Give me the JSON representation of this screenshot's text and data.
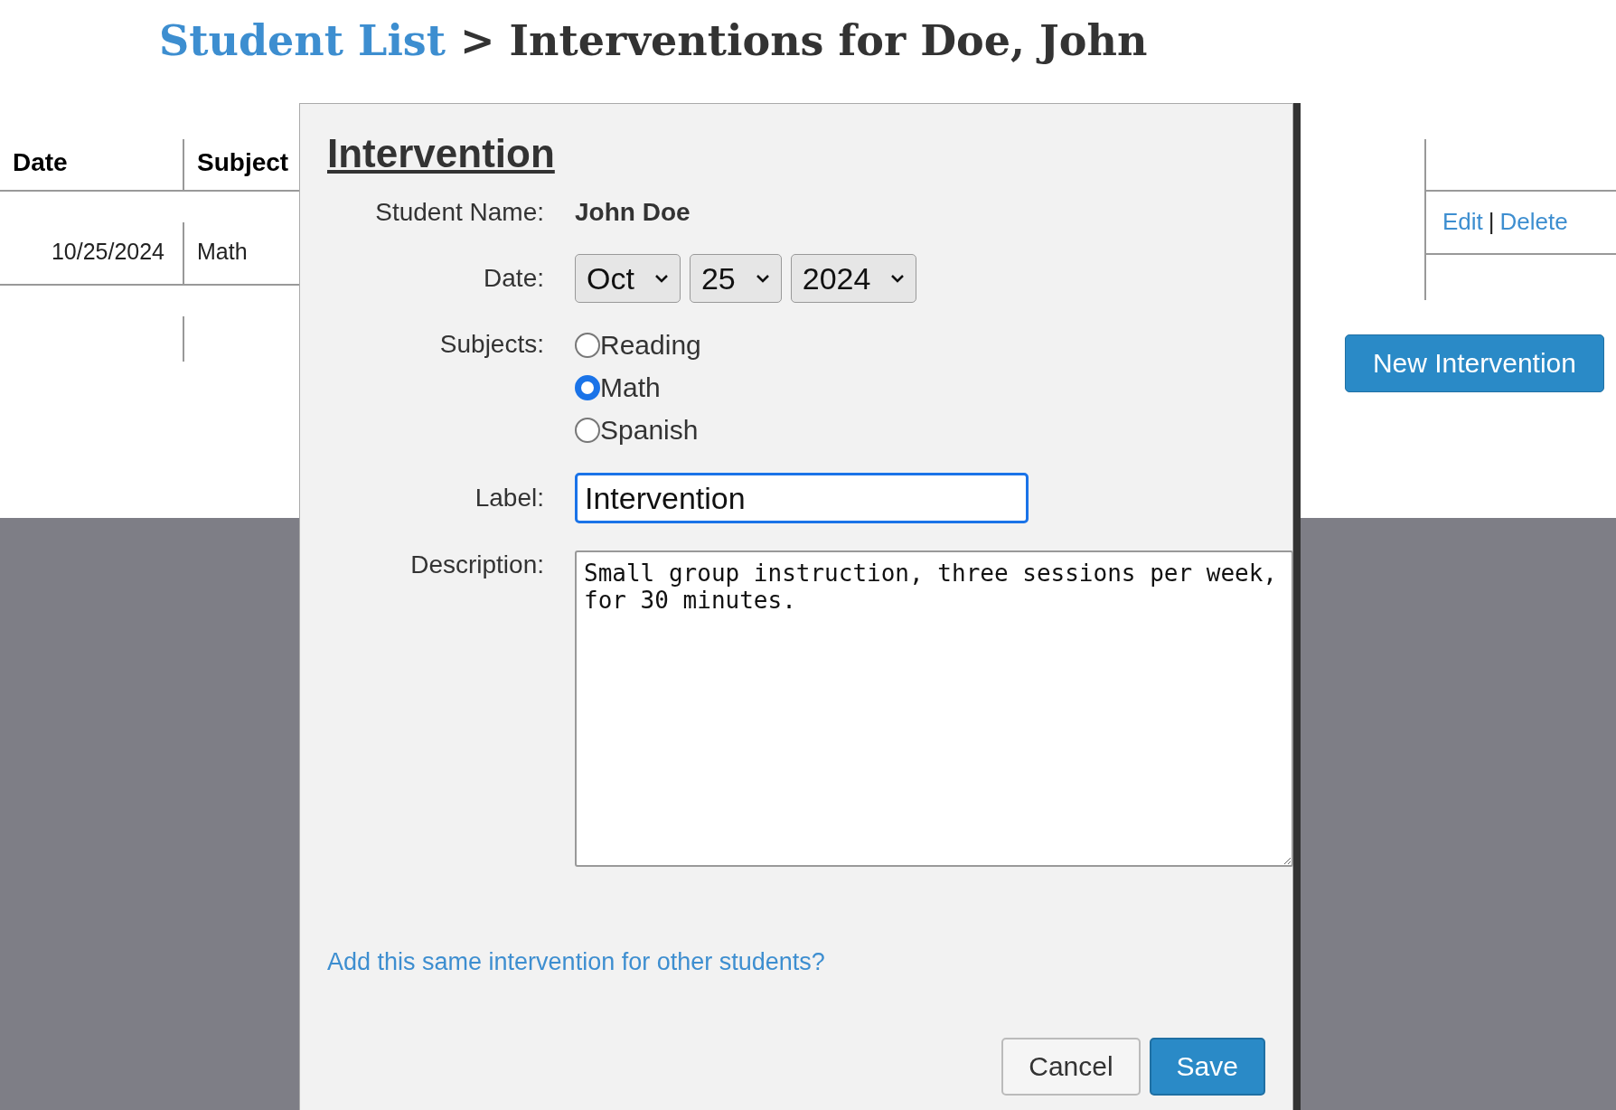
{
  "breadcrumb": {
    "link": "Student List",
    "separator": ">",
    "title": "Interventions for Doe, John"
  },
  "table": {
    "columns": [
      "Date",
      "Subject"
    ],
    "rows": [
      {
        "date": "10/25/2024",
        "subject": "Math",
        "actions": [
          "Edit",
          "Delete"
        ],
        "action_separator": "|"
      }
    ]
  },
  "new_button": "New Intervention",
  "dialog": {
    "title": "Intervention",
    "student_label": "Student Name:",
    "student_name": "John Doe",
    "date_label": "Date:",
    "date": [
      {
        "value": "Oct"
      },
      {
        "value": "25"
      },
      {
        "value": "2024"
      }
    ],
    "subjects_label": "Subjects:",
    "subjects": [
      {
        "label": "Reading",
        "selected": false
      },
      {
        "label": "Math",
        "selected": true
      },
      {
        "label": "Spanish",
        "selected": false
      }
    ],
    "label_label": "Label:",
    "label_value": "Intervention",
    "description_label": "Description:",
    "description_value": "Small group instruction, three sessions per week, for 30 minutes.",
    "link": "Add this same intervention for other students?",
    "buttons": [
      {
        "label": "Cancel",
        "kind": "secondary"
      },
      {
        "label": "Save",
        "kind": "primary"
      }
    ]
  }
}
